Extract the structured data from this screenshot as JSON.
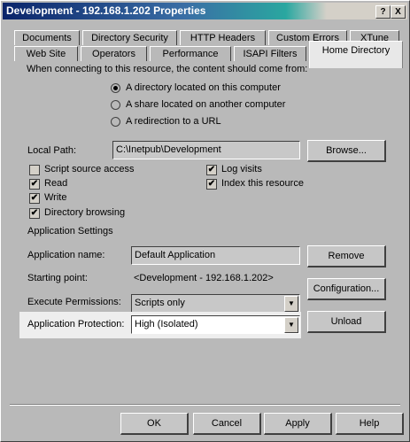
{
  "window": {
    "title": "Development - 192.168.1.202 Properties"
  },
  "title_buttons": {
    "help": "?",
    "close": "X"
  },
  "tabs_row1": [
    "Documents",
    "Directory Security",
    "HTTP Headers",
    "Custom Errors",
    "XTune"
  ],
  "tabs_row2": [
    "Web Site",
    "Operators",
    "Performance",
    "ISAPI Filters",
    "Home Directory"
  ],
  "intro": "When connecting to this resource, the content should come from:",
  "radios": [
    {
      "label": "A directory located on this computer",
      "checked": true
    },
    {
      "label": "A share located on another computer",
      "checked": false
    },
    {
      "label": "A redirection to a URL",
      "checked": false
    }
  ],
  "local_path": {
    "label": "Local Path:",
    "value": "C:\\Inetpub\\Development",
    "browse": "Browse..."
  },
  "checks_left": [
    {
      "label": "Script source access",
      "checked": false
    },
    {
      "label": "Read",
      "checked": true
    },
    {
      "label": "Write",
      "checked": true
    },
    {
      "label": "Directory browsing",
      "checked": true
    }
  ],
  "checks_right": [
    {
      "label": "Log visits",
      "checked": true
    },
    {
      "label": "Index this resource",
      "checked": true
    }
  ],
  "app_settings": {
    "heading": "Application Settings",
    "name_label": "Application name:",
    "name_value": "Default Application",
    "start_label": "Starting point:",
    "start_value": "<Development - 192.168.1.202>",
    "exec_label": "Execute Permissions:",
    "exec_value": "Scripts only",
    "protect_label": "Application Protection:",
    "protect_value": "High (Isolated)",
    "remove": "Remove",
    "config": "Configuration...",
    "unload": "Unload"
  },
  "footer": {
    "ok": "OK",
    "cancel": "Cancel",
    "apply": "Apply",
    "help": "Help"
  },
  "colors": {
    "titlebar_start": "#0a246a",
    "titlebar_end": "#2aa7a0",
    "face": "#b9b9b9"
  }
}
